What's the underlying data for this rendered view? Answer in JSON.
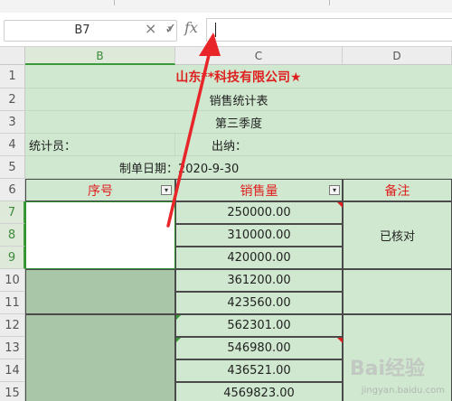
{
  "name_box": {
    "value": "B7"
  },
  "formula_bar": {
    "cancel_icon": "×",
    "confirm_icon": "✓",
    "fx_label": "fx",
    "value": ""
  },
  "columns": [
    "B",
    "C",
    "D"
  ],
  "rows": [
    "1",
    "2",
    "3",
    "4",
    "5",
    "6",
    "7",
    "8",
    "9",
    "10",
    "11",
    "12",
    "13",
    "14",
    "15"
  ],
  "sheet": {
    "title": "山东**科技有限公司★",
    "subtitle": "销售统计表",
    "quarter": "第三季度",
    "stat_label": "统计员：",
    "cashier_label": "出纳：",
    "date_label": "制单日期：2020-9-30",
    "headers": {
      "seq": "序号",
      "sales": "销售量",
      "note": "备注"
    },
    "sales": [
      "250000.00",
      "310000.00",
      "420000.00",
      "361200.00",
      "423560.00",
      "562301.00",
      "546980.00",
      "436521.00",
      "4569823.00"
    ],
    "note_checked": "已核对"
  },
  "watermark": {
    "text": "Bai经验",
    "sub": "jingyan.baidu.com"
  },
  "colors": {
    "cell_bg": "#cfe8cf",
    "red": "#e02020",
    "selected_green": "#3a9a3a",
    "arrow": "#e8262a"
  }
}
